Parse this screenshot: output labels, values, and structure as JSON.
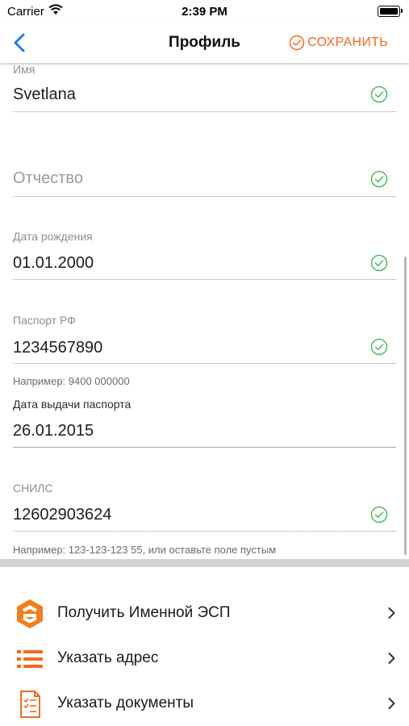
{
  "status_bar": {
    "carrier": "Carrier",
    "time": "2:39 PM"
  },
  "nav": {
    "title": "Профиль",
    "save_label": "СОХРАНИТЬ"
  },
  "form": {
    "name": {
      "label": "Имя",
      "value": "Svetlana"
    },
    "patronymic": {
      "placeholder": "Отчество"
    },
    "birth_date": {
      "label": "Дата рождения",
      "value": "01.01.2000"
    },
    "passport": {
      "label": "Паспорт РФ",
      "value": "1234567890",
      "hint": "Например: 9400 000000"
    },
    "passport_issue_date": {
      "label": "Дата выдачи паспорта",
      "value": "26.01.2015"
    },
    "snils": {
      "label": "СНИЛС",
      "value": "12602903624",
      "hint": "Например: 123-123-123 55, или оставьте поле пустым"
    }
  },
  "menu": [
    {
      "label": "Получить Именной ЭСП",
      "icon": "esp-logo-icon"
    },
    {
      "label": "Указать адрес",
      "icon": "list-icon"
    },
    {
      "label": "Указать документы",
      "icon": "document-icon"
    }
  ],
  "colors": {
    "accent": "#f26b1d",
    "back_blue": "#1e7cf2",
    "check_green": "#4cbb5f"
  }
}
